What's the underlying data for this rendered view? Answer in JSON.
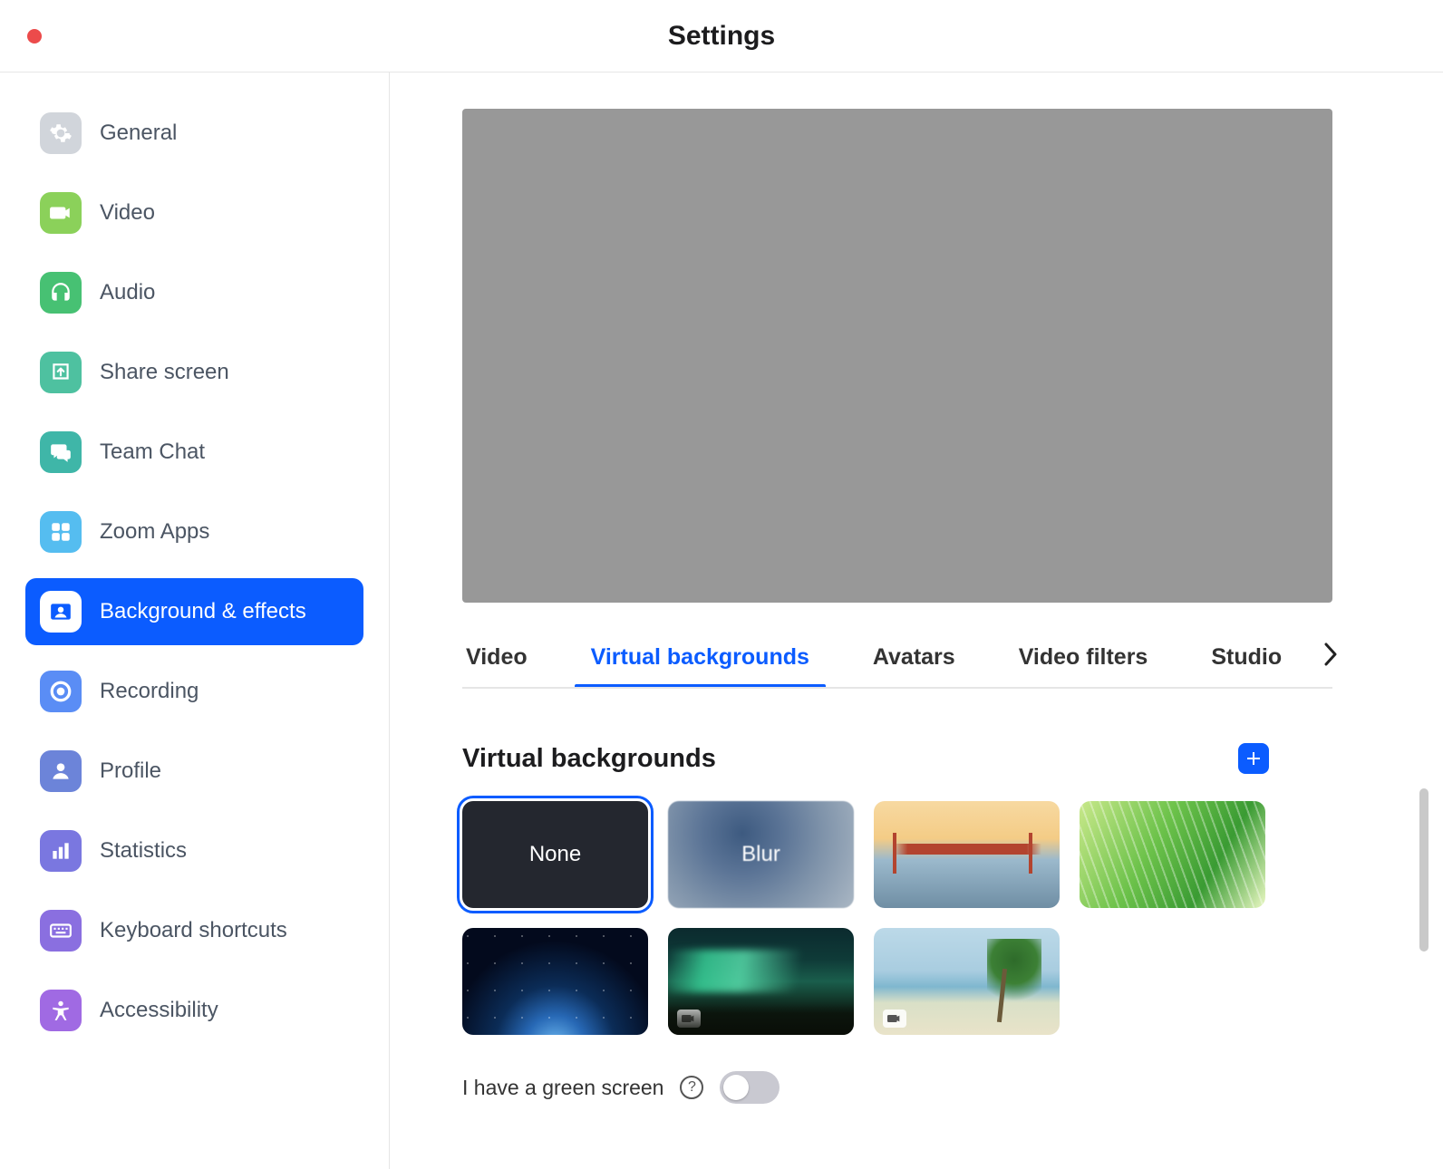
{
  "window": {
    "title": "Settings"
  },
  "sidebar": {
    "items": [
      {
        "id": "general",
        "label": "General",
        "icon": "gear-icon",
        "color": "#d1d5db",
        "active": false
      },
      {
        "id": "video",
        "label": "Video",
        "icon": "video-icon",
        "color": "#8bd15a",
        "active": false
      },
      {
        "id": "audio",
        "label": "Audio",
        "icon": "headphones-icon",
        "color": "#47c173",
        "active": false
      },
      {
        "id": "share-screen",
        "label": "Share screen",
        "icon": "share-up-icon",
        "color": "#4ec1a0",
        "active": false
      },
      {
        "id": "team-chat",
        "label": "Team Chat",
        "icon": "chat-icon",
        "color": "#3fb6a8",
        "active": false
      },
      {
        "id": "zoom-apps",
        "label": "Zoom Apps",
        "icon": "apps-icon",
        "color": "#55bdf0",
        "active": false
      },
      {
        "id": "background-effects",
        "label": "Background & effects",
        "icon": "person-card-icon",
        "color": "#0b5cff",
        "active": true
      },
      {
        "id": "recording",
        "label": "Recording",
        "icon": "record-icon",
        "color": "#5a8df5",
        "active": false
      },
      {
        "id": "profile",
        "label": "Profile",
        "icon": "person-icon",
        "color": "#6c84d9",
        "active": false
      },
      {
        "id": "statistics",
        "label": "Statistics",
        "icon": "bar-chart-icon",
        "color": "#7a77e0",
        "active": false
      },
      {
        "id": "keyboard-shortcuts",
        "label": "Keyboard shortcuts",
        "icon": "keyboard-icon",
        "color": "#8a6fe0",
        "active": false
      },
      {
        "id": "accessibility",
        "label": "Accessibility",
        "icon": "accessibility-icon",
        "color": "#a06ae3",
        "active": false
      }
    ]
  },
  "tabs": {
    "items": [
      {
        "id": "video",
        "label": "Video",
        "active": false
      },
      {
        "id": "virtual-backgrounds",
        "label": "Virtual backgrounds",
        "active": true
      },
      {
        "id": "avatars",
        "label": "Avatars",
        "active": false
      },
      {
        "id": "video-filters",
        "label": "Video filters",
        "active": false
      },
      {
        "id": "studio",
        "label": "Studio",
        "active": false
      }
    ]
  },
  "section": {
    "title": "Virtual backgrounds",
    "add_label": "Add"
  },
  "backgrounds": [
    {
      "id": "none",
      "label": "None",
      "selected": true,
      "kind": "none",
      "isVideo": false
    },
    {
      "id": "blur",
      "label": "Blur",
      "selected": false,
      "kind": "blur",
      "isVideo": false
    },
    {
      "id": "bridge",
      "label": "",
      "selected": false,
      "kind": "bridge",
      "isVideo": false
    },
    {
      "id": "grass",
      "label": "",
      "selected": false,
      "kind": "grass",
      "isVideo": false
    },
    {
      "id": "earth",
      "label": "",
      "selected": false,
      "kind": "earth",
      "isVideo": false
    },
    {
      "id": "aurora",
      "label": "",
      "selected": false,
      "kind": "aurora",
      "isVideo": true
    },
    {
      "id": "beach",
      "label": "",
      "selected": false,
      "kind": "beach",
      "isVideo": true
    }
  ],
  "greenScreen": {
    "label": "I have a green screen",
    "enabled": false
  }
}
